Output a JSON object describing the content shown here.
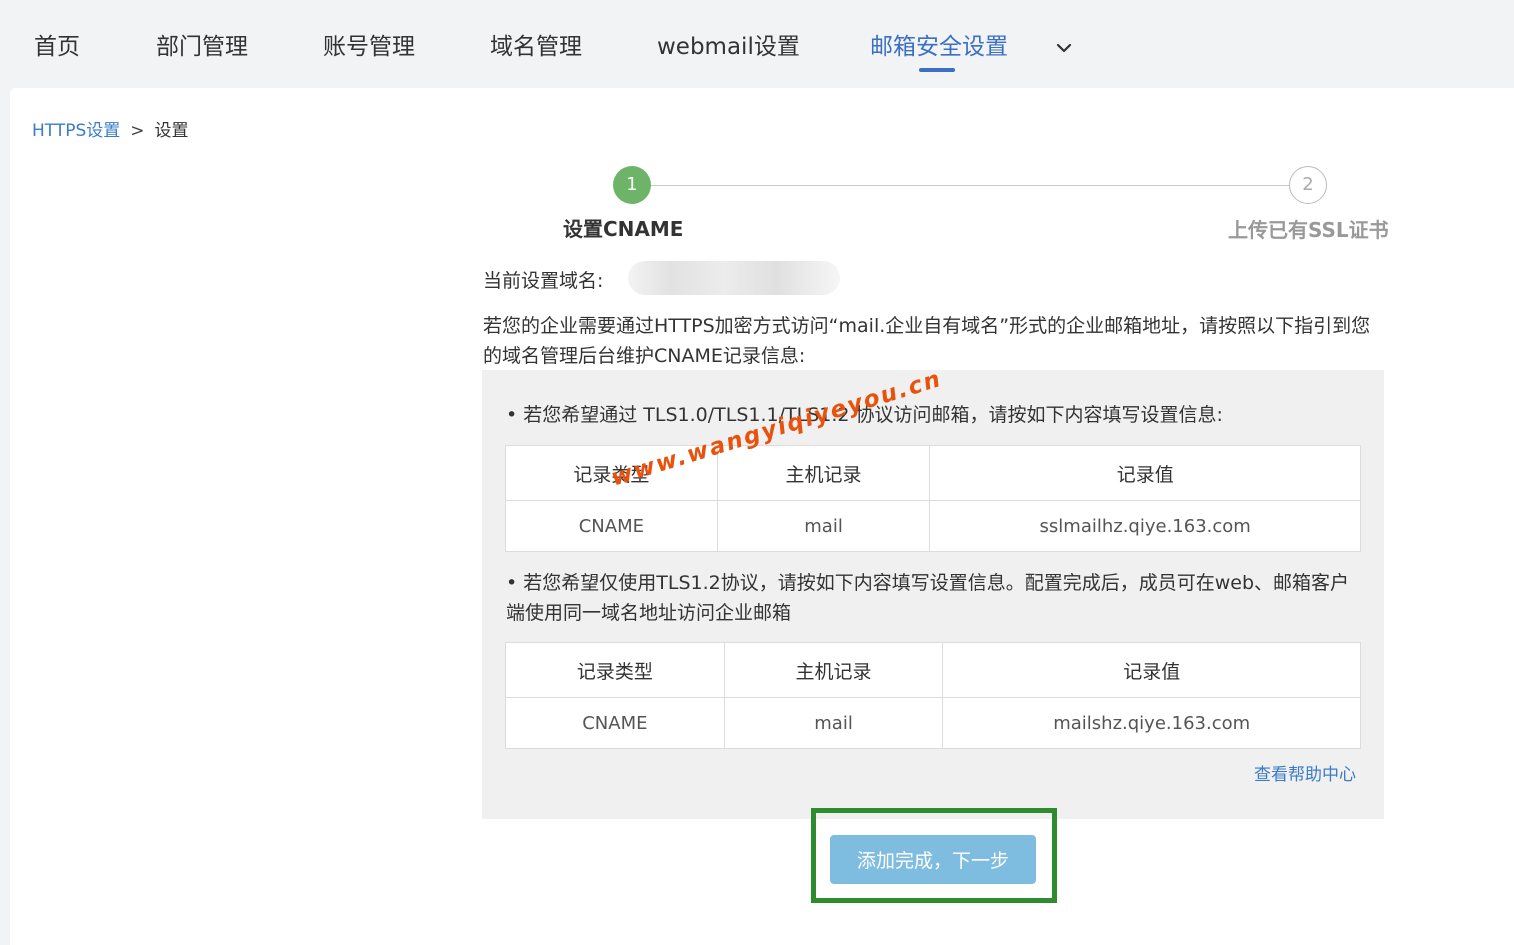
{
  "nav": {
    "items": [
      {
        "label": "首页"
      },
      {
        "label": "部门管理"
      },
      {
        "label": "账号管理"
      },
      {
        "label": "域名管理"
      },
      {
        "label": "webmail设置"
      },
      {
        "label": "邮箱安全设置",
        "active": true
      }
    ],
    "more_icon": "chevron-down-icon"
  },
  "breadcrumb": {
    "parent": "HTTPS设置",
    "separator": ">",
    "current": "设置"
  },
  "stepper": {
    "steps": [
      {
        "number": "1",
        "label": "设置CNAME",
        "status": "active"
      },
      {
        "number": "2",
        "label": "上传已有SSL证书",
        "status": "pending"
      }
    ]
  },
  "domain": {
    "label": "当前设置域名:"
  },
  "intro": "若您的企业需要通过HTTPS加密方式访问“mail.企业自有域名”形式的企业邮箱地址，请按照以下指引到您的域名管理后台维护CNAME记录信息:",
  "section1": {
    "text": "• 若您希望通过 TLS1.0/TLS1.1/TLS1.2 协议访问邮箱，请按如下内容填写设置信息:",
    "headers": [
      "记录类型",
      "主机记录",
      "记录值"
    ],
    "row": [
      "CNAME",
      "mail",
      "sslmailhz.qiye.163.com"
    ]
  },
  "section2": {
    "text": "• 若您希望仅使用TLS1.2协议，请按如下内容填写设置信息。配置完成后，成员可在web、邮箱客户端使用同一域名地址访问企业邮箱",
    "headers": [
      "记录类型",
      "主机记录",
      "记录值"
    ],
    "row": [
      "CNAME",
      "mail",
      "mailshz.qiye.163.com"
    ]
  },
  "help_link": "查看帮助中心",
  "next_button": "添加完成，下一步",
  "watermark": "www.wangyiqiyeyou.cn",
  "colors": {
    "accent": "#3a6fc4",
    "step_active": "#6db469",
    "button": "#7fbde0",
    "highlight_frame": "#2e8b2e",
    "watermark": "#e8520c"
  }
}
